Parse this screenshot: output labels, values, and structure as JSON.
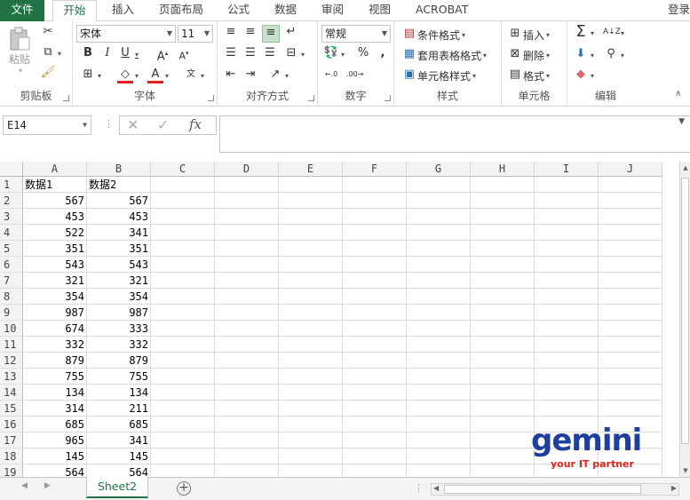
{
  "tabs": [
    "文件",
    "开始",
    "插入",
    "页面布局",
    "公式",
    "数据",
    "审阅",
    "视图",
    "ACROBAT"
  ],
  "login": "登录",
  "ribbon": {
    "clipboard": {
      "label": "剪贴板",
      "paste": "粘贴"
    },
    "font": {
      "label": "字体",
      "name": "宋体",
      "size": "11",
      "bold": "B",
      "italic": "I",
      "underline": "U"
    },
    "align": {
      "label": "对齐方式"
    },
    "number": {
      "label": "数字",
      "format": "常规",
      "percent": "%",
      "comma": ","
    },
    "styles": {
      "label": "样式",
      "cond": "条件格式",
      "table": "套用表格格式",
      "cell": "单元格样式"
    },
    "cells": {
      "label": "单元格",
      "insert": "插入",
      "delete": "删除",
      "format": "格式"
    },
    "edit": {
      "label": "编辑"
    }
  },
  "formula": {
    "namebox": "E14",
    "fx": "fx",
    "content": ""
  },
  "columns": [
    "A",
    "B",
    "C",
    "D",
    "E",
    "F",
    "G",
    "H",
    "I",
    "J"
  ],
  "rows": [
    [
      "数据1",
      "数据2"
    ],
    [
      "567",
      "567"
    ],
    [
      "453",
      "453"
    ],
    [
      "522",
      "341"
    ],
    [
      "351",
      "351"
    ],
    [
      "543",
      "543"
    ],
    [
      "321",
      "321"
    ],
    [
      "354",
      "354"
    ],
    [
      "987",
      "987"
    ],
    [
      "674",
      "333"
    ],
    [
      "332",
      "332"
    ],
    [
      "879",
      "879"
    ],
    [
      "755",
      "755"
    ],
    [
      "134",
      "134"
    ],
    [
      "314",
      "211"
    ],
    [
      "685",
      "685"
    ],
    [
      "965",
      "341"
    ],
    [
      "145",
      "145"
    ],
    [
      "564",
      "564"
    ]
  ],
  "sheet": {
    "name": "Sheet2",
    "add": "+"
  },
  "logo": {
    "word": "gemini",
    "tag": "your IT partner"
  },
  "colors": {
    "accent": "#217346",
    "logo_blue": "#1f3f9e",
    "logo_red": "#d9261c"
  }
}
